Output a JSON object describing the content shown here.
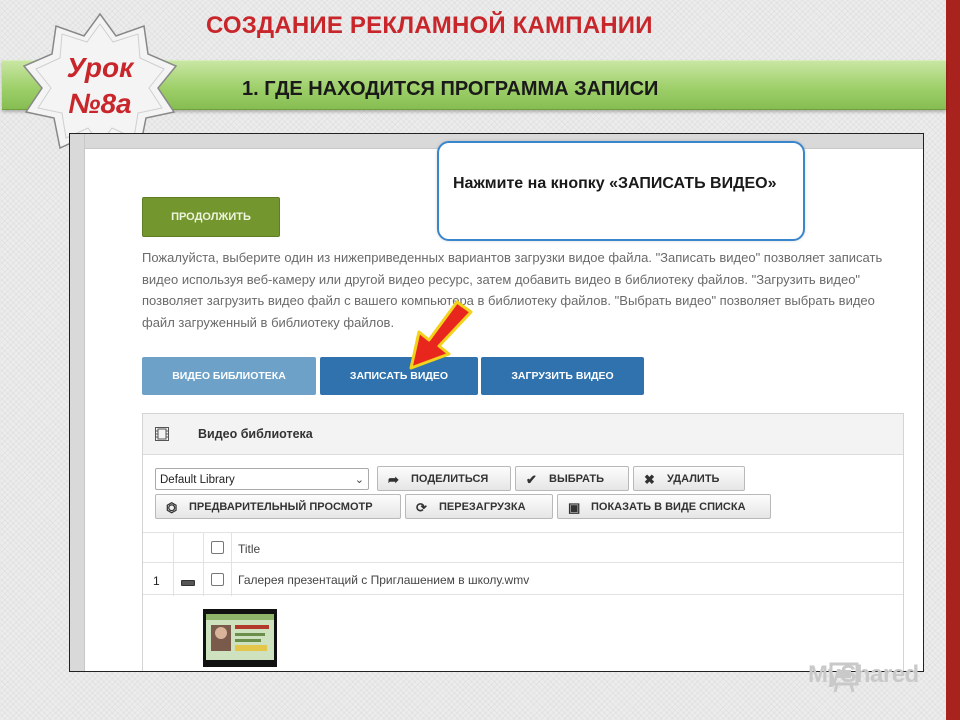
{
  "slide": {
    "title": "СОЗДАНИЕ РЕКЛАМНОЙ КАМПАНИИ",
    "subtitle_number": "1.",
    "subtitle_text": "ГДЕ НАХОДИТСЯ ПРОГРАММА ЗАПИСИ",
    "badge_line1": "Урок",
    "badge_line2": "№8а",
    "callout_text": "Нажмите на кнопку «ЗАПИСАТЬ ВИДЕО»",
    "watermark": "MyShared",
    "colors": {
      "accent_red": "#c8262a",
      "band_green": "#9fd06b",
      "callout_border": "#3a86cc",
      "arrow_red": "#e8261e"
    }
  },
  "app": {
    "continue_button": "ПРОДОЛЖИТЬ",
    "description": "Пожалуйста, выберите один из нижеприведенных вариантов загрузки видое файла. \"Записать видео\" позволяет записать видео используя веб-камеру или другой видео ресурс, затем добавить видео в библиотеку файлов. \"Загрузить видео\" позволяет загрузить видео файл с вашего компьютера в библиотеку файлов. \"Выбрать видео\" позволяет выбрать видео файл загруженный в библиотеку файлов.",
    "tabs": {
      "library": "ВИДЕО БИБЛИОТЕКА",
      "record": "ЗАПИСАТЬ ВИДЕО",
      "upload": "ЗАГРУЗИТЬ ВИДЕО"
    },
    "panel": {
      "title": "Видео библиотека",
      "library_select": "Default Library",
      "toolbar": {
        "share": "ПОДЕЛИТЬСЯ",
        "choose": "ВЫБРАТЬ",
        "delete": "УДАЛИТЬ",
        "preview": "ПРЕДВАРИТЕЛЬНЫЙ ПРОСМОТР",
        "reload": "ПЕРЕЗАГРУЗКА",
        "list_view": "ПОКАЗАТЬ В ВИДЕ СПИСКА"
      },
      "table": {
        "column_title": "Title",
        "rows": [
          {
            "num": "1",
            "name": "Галерея презентаций с Приглашением в школу.wmv"
          }
        ]
      }
    }
  }
}
